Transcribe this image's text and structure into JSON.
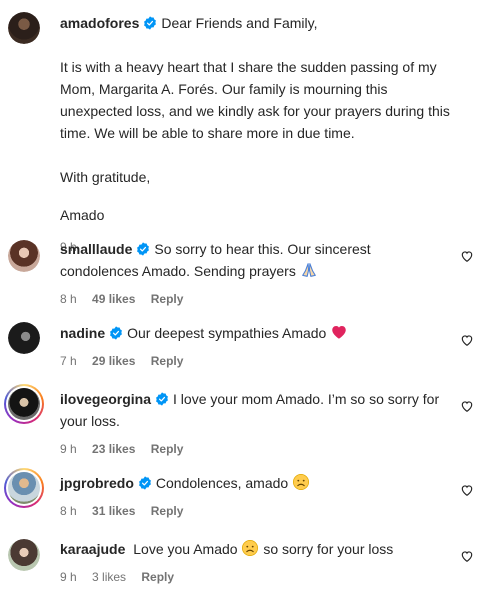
{
  "post": {
    "username": "amadofores",
    "greeting": "Dear Friends and Family,",
    "paragraph": "It is with a heavy heart that I share the sudden passing of my Mom, Margarita A. Forés. Our family is mourning this unexpected loss, and we kindly ask for your prayers during this time. We will be able to share more in due time.",
    "closing": "With gratitude,",
    "signature": "Amado",
    "time": "9 h"
  },
  "comments": [
    {
      "username": "smalllaude",
      "text": "So sorry to hear this. Our sincerest condolences Amado. Sending prayers",
      "emoji": "praying-hands",
      "time": "8 h",
      "likes": "49 likes",
      "reply": "Reply",
      "verified": true
    },
    {
      "username": "nadine",
      "text": "Our deepest sympathies Amado",
      "emoji": "red-heart",
      "time": "7 h",
      "likes": "29 likes",
      "reply": "Reply",
      "verified": true
    },
    {
      "username": "ilovegeorgina",
      "text": "I love your mom Amado. I’m so so sorry for your loss.",
      "time": "9 h",
      "likes": "23 likes",
      "reply": "Reply",
      "verified": true
    },
    {
      "username": "jpgrobredo",
      "text": "Condolences, amado",
      "emoji": "sad-face",
      "time": "8 h",
      "likes": "31 likes",
      "reply": "Reply",
      "verified": true
    },
    {
      "username": "karaajude",
      "text_before": "Love you Amado",
      "text_after": "so sorry for your loss",
      "emoji": "sad-face",
      "time": "9 h",
      "likes": "3 likes",
      "reply": "Reply",
      "verified": false
    }
  ],
  "colors": {
    "verified": "#0095f6",
    "meta": "#737373",
    "text": "#262626"
  }
}
